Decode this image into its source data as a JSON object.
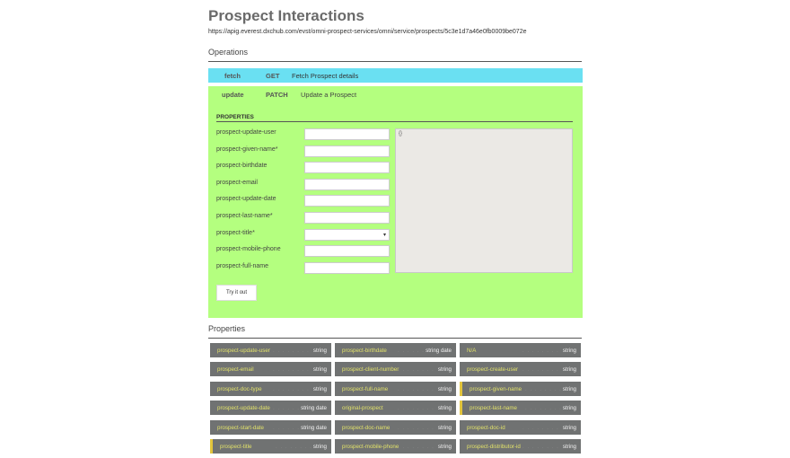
{
  "page": {
    "title": "Prospect Interactions",
    "url": "https://apig.everest.dxchub.com/evst/omni-prospect-services/omni/service/prospects/5c3e1d7a46e0fb0009be072e",
    "operations_heading": "Operations",
    "properties_heading": "Properties"
  },
  "operations": [
    {
      "name": "fetch",
      "method": "GET",
      "description": "Fetch Prospect details"
    },
    {
      "name": "update",
      "method": "PATCH",
      "description": "Update a Prospect"
    }
  ],
  "form": {
    "properties_title": "PROPERTIES",
    "fields": [
      {
        "label": "prospect-update-user",
        "value": ""
      },
      {
        "label": "prospect-given-name*",
        "value": ""
      },
      {
        "label": "prospect-birthdate",
        "value": ""
      },
      {
        "label": "prospect-email",
        "value": ""
      },
      {
        "label": "prospect-update-date",
        "value": ""
      },
      {
        "label": "prospect-last-name*",
        "value": ""
      },
      {
        "label": "prospect-title*",
        "value": "",
        "type": "select"
      },
      {
        "label": "prospect-mobile-phone",
        "value": ""
      },
      {
        "label": "prospect-full-name",
        "value": ""
      }
    ],
    "body_textarea": "{}",
    "try_button": "Try it out"
  },
  "properties": [
    {
      "name": "prospect-update-user",
      "type": "string"
    },
    {
      "name": "prospect-birthdate",
      "type": "string date"
    },
    {
      "name": "N/A",
      "type": "string"
    },
    {
      "name": "prospect-email",
      "type": "string"
    },
    {
      "name": "prospect-client-number",
      "type": "string"
    },
    {
      "name": "prospect-create-user",
      "type": "string"
    },
    {
      "name": "prospect-doc-type",
      "type": "string"
    },
    {
      "name": "prospect-full-name",
      "type": "string"
    },
    {
      "name": "prospect-given-name",
      "type": "string",
      "marked": true
    },
    {
      "name": "prospect-update-date",
      "type": "string date"
    },
    {
      "name": "original-prospect",
      "type": "string"
    },
    {
      "name": "prospect-last-name",
      "type": "string",
      "marked": true
    },
    {
      "name": "prospect-start-date",
      "type": "string date"
    },
    {
      "name": "prospect-doc-name",
      "type": "string"
    },
    {
      "name": "prospect-doc-id",
      "type": "string"
    },
    {
      "name": "prospect-title",
      "type": "string",
      "marked": true
    },
    {
      "name": "prospect-mobile-phone",
      "type": "string"
    },
    {
      "name": "prospect-distributor-id",
      "type": "string"
    }
  ]
}
